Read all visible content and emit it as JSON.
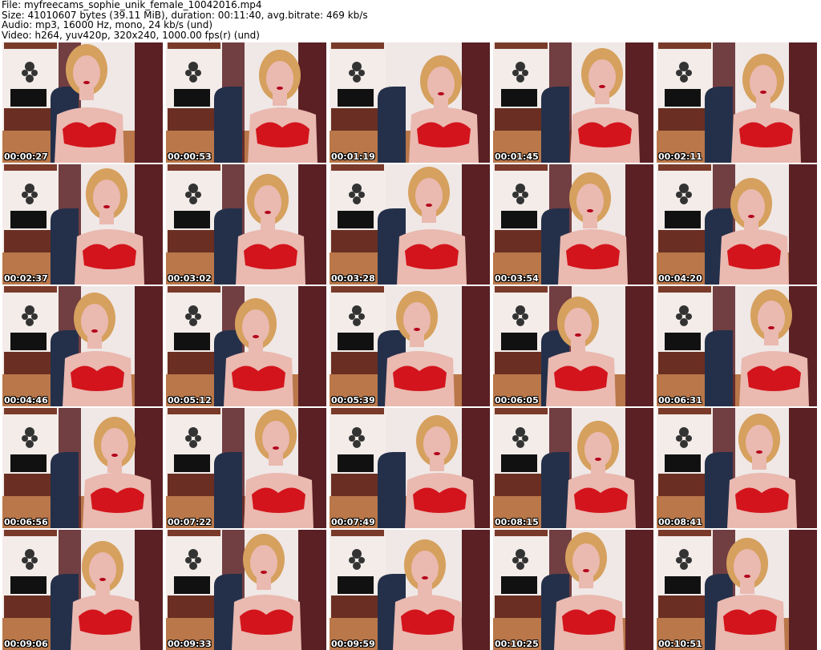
{
  "header": {
    "file": "File: myfreecams_sophie_unik_female_10042016.mp4",
    "size": "Size: 41010607 bytes (39.11 MiB), duration: 00:11:40, avg.bitrate: 469 kb/s",
    "audio": "Audio: mp3, 16000 Hz, mono, 24 kb/s (und)",
    "video": "Video: h264, yuv420p, 320x240, 1000.00 fps(r) (und)"
  },
  "thumbnails": [
    {
      "time": "00:00:27"
    },
    {
      "time": "00:00:53"
    },
    {
      "time": "00:01:19"
    },
    {
      "time": "00:01:45"
    },
    {
      "time": "00:02:11"
    },
    {
      "time": "00:02:37"
    },
    {
      "time": "00:03:02"
    },
    {
      "time": "00:03:28"
    },
    {
      "time": "00:03:54"
    },
    {
      "time": "00:04:20"
    },
    {
      "time": "00:04:46"
    },
    {
      "time": "00:05:12"
    },
    {
      "time": "00:05:39"
    },
    {
      "time": "00:06:05"
    },
    {
      "time": "00:06:31"
    },
    {
      "time": "00:06:56"
    },
    {
      "time": "00:07:22"
    },
    {
      "time": "00:07:49"
    },
    {
      "time": "00:08:15"
    },
    {
      "time": "00:08:41"
    },
    {
      "time": "00:09:06"
    },
    {
      "time": "00:09:33"
    },
    {
      "time": "00:09:59"
    },
    {
      "time": "00:10:25"
    },
    {
      "time": "00:10:51"
    }
  ],
  "colors": {
    "background": "#ffffff",
    "wall": "#efe8e6",
    "curtain": "#5a2024",
    "floor": "#b9774a",
    "top": "#d3141c",
    "hair": "#d6a05e",
    "skin": "#eab9b0",
    "chair": "#24304a"
  }
}
